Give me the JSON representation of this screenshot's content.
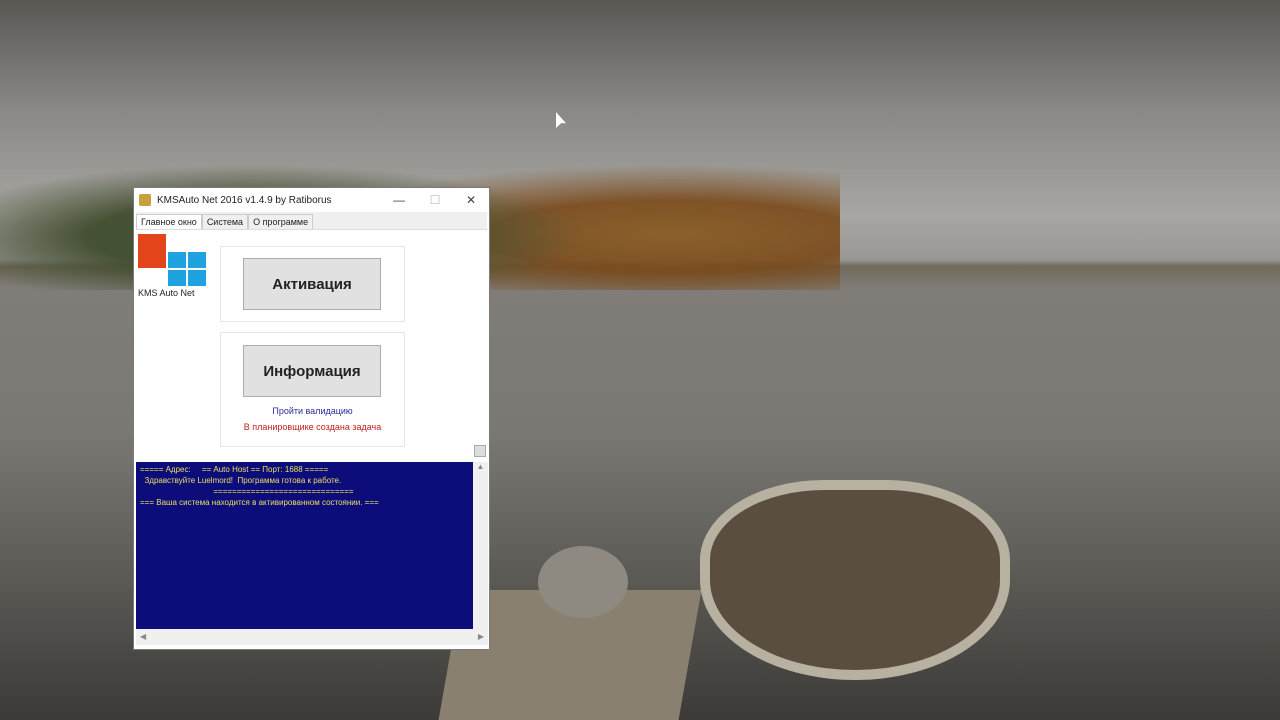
{
  "window": {
    "title": "KMSAuto Net 2016 v1.4.9 by Ratiborus",
    "minimize": "—",
    "maximize": "☐",
    "close": "✕"
  },
  "tabs": [
    "Главное окно",
    "Система",
    "О программе"
  ],
  "logo": {
    "text": "KMS Auto Net"
  },
  "buttons": {
    "activation": "Активация",
    "information": "Информация"
  },
  "links": {
    "validation": "Пройти валидацию",
    "scheduler": "В планировщике создана задача"
  },
  "console": {
    "lines": [
      "===== Адрес:     == Auto Host == Порт: 1688 =====",
      "  Здравствуйте Luelmord!  Программа готова к работе.",
      "                                 ==============================",
      "=== Ваша система находится в активированном состоянии. ==="
    ]
  },
  "scroll": {
    "up": "▲",
    "left": "◀",
    "right": "▶"
  },
  "colors": {
    "console_bg": "#0c0c7a",
    "console_text": "#e8e060",
    "link": "#2a2aa0",
    "status": "#c02020"
  }
}
